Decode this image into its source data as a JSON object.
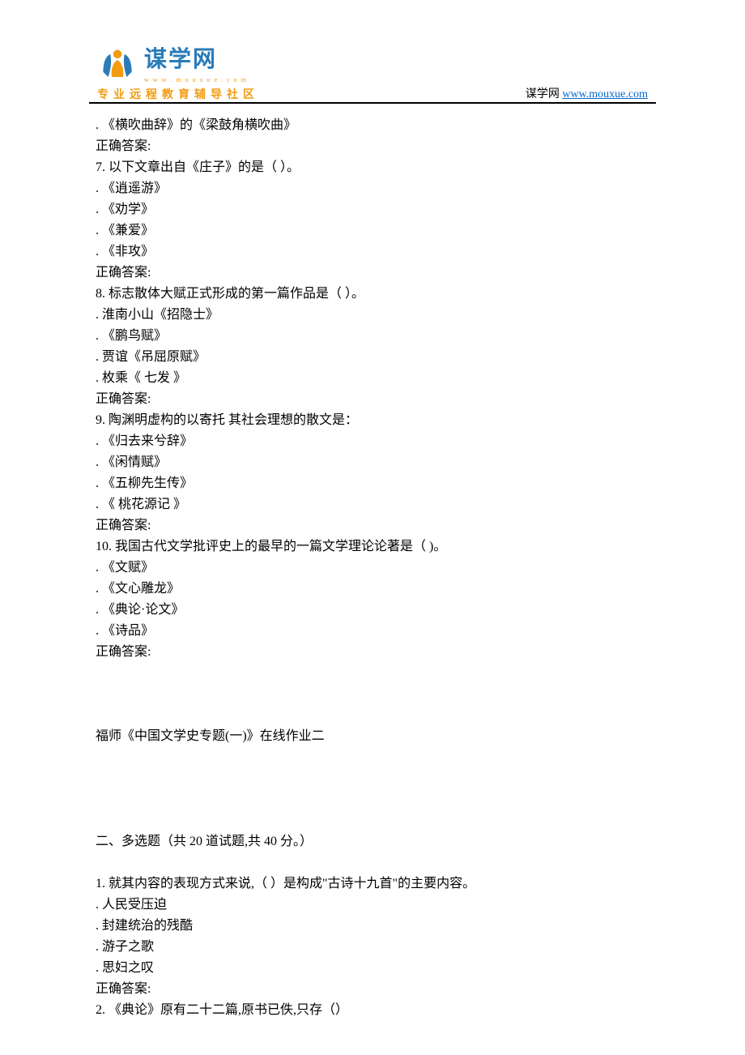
{
  "header": {
    "logo_title": "谋学网",
    "tagline": "专业远程教育辅导社区",
    "site_label": "谋学网 ",
    "site_url": "www.mouxue.com"
  },
  "content": {
    "lines": [
      ".  《横吹曲辞》的《梁鼓角横吹曲》",
      "正确答案:",
      "7.   以下文章出自《庄子》的是（ ）。",
      ".  《逍遥游》",
      ".  《劝学》",
      ".  《兼爱》",
      ".  《非攻》",
      "正确答案:",
      "8.   标志散体大赋正式形成的第一篇作品是（ ）。",
      ".  淮南小山《招隐士》",
      ".  《鹏鸟赋》",
      ".  贾谊《吊屈原赋》",
      ".  枚乘《 七发 》",
      "正确答案:",
      "9.   陶渊明虚构的以寄托 其社会理想的散文是：",
      ".  《归去来兮辞》",
      ".  《闲情赋》",
      ".  《五柳先生传》",
      ".  《 桃花源记 》",
      "正确答案:",
      "10.   我国古代文学批评史上的最早的一篇文学理论论著是（ )。",
      ".  《文赋》",
      ".  《文心雕龙》",
      ".  《典论·论文》",
      ".  《诗品》",
      "正确答案:",
      "",
      "",
      "",
      "福师《中国文学史专题(一)》在线作业二",
      "",
      "",
      "",
      "",
      "二、多选题（共 20 道试题,共 40 分。）",
      "",
      "1.   就其内容的表现方式来说,（ ）是构成\"古诗十九首\"的主要内容。",
      ".  人民受压迫",
      ".  封建统治的残酷",
      ".  游子之歌",
      ".  思妇之叹",
      "正确答案:",
      "2.   《典论》原有二十二篇,原书已佚,只存（）"
    ]
  }
}
